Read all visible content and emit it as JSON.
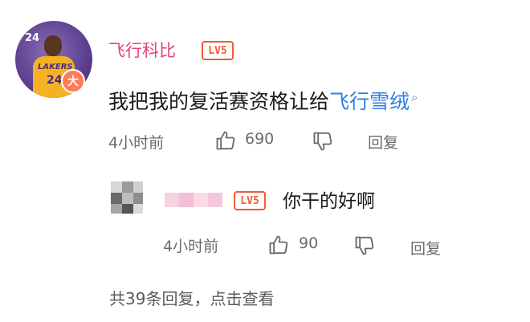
{
  "comment": {
    "username": "飞行科比",
    "level": "LV5",
    "avatar_badge": "大",
    "avatar_art_text": "24",
    "text": "我把我的复活赛资格让给",
    "mention": "飞行雪绒",
    "time": "4小时前",
    "likes": "690",
    "reply_label": "回复"
  },
  "reply": {
    "level": "LV5",
    "text": "你干的好啊",
    "time": "4小时前",
    "likes": "90",
    "reply_label": "回复"
  },
  "more_replies": "共39条回复，点击查看",
  "colors": {
    "username": "#e0457d",
    "level_badge": "#f05c38",
    "mention": "#2f7fe0",
    "meta_text": "#6b6b6b"
  }
}
